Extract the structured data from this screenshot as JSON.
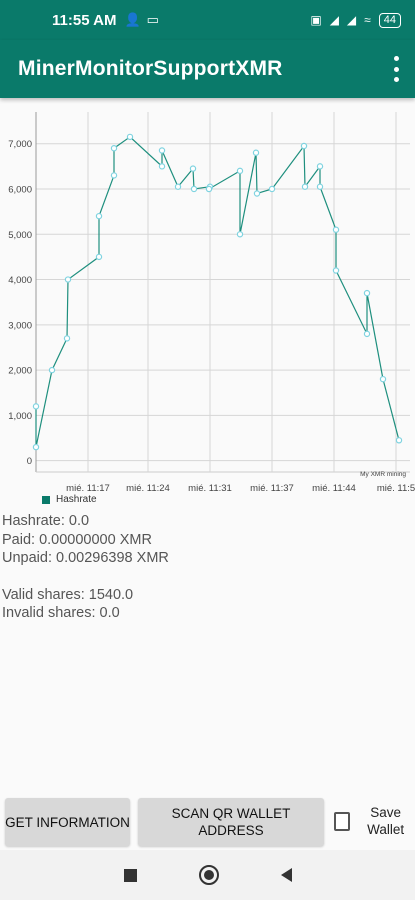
{
  "status_bar": {
    "time": "11:55 AM",
    "left_icons": [
      "person-add-icon",
      "laptop-icon"
    ],
    "right_icons": [
      "screenshot-icon",
      "signal-icon",
      "signal-icon-2",
      "wifi-icon"
    ],
    "battery": "44"
  },
  "app_bar": {
    "title": "MinerMonitorSupportXMR",
    "overflow_icon": "more-vert-icon"
  },
  "chart_data": {
    "type": "line",
    "series": [
      {
        "name": "Hashrate",
        "color": "#1e8f7e",
        "values": [
          1200,
          300,
          2000,
          2700,
          4000,
          4500,
          5400,
          6300,
          6900,
          7150,
          6500,
          6850,
          6050,
          6450,
          6000,
          6050,
          6000,
          6000,
          6400,
          5000,
          6800,
          5900,
          6000,
          6950,
          6050,
          6500,
          6050,
          5100,
          4200,
          2800,
          3700,
          1800,
          450
        ]
      }
    ],
    "x_labels": [
      "mié. 11:17",
      "mié. 11:24",
      "mié. 11:31",
      "mié. 11:37",
      "mié. 11:44",
      "mié. 11:5"
    ],
    "y_ticks": [
      "7,000",
      "6,000",
      "5,000",
      "4,000",
      "3,000",
      "2,000",
      "1,000",
      "0"
    ],
    "ylim": [
      -250,
      7700
    ],
    "description_label": "My XMR mining",
    "legend": [
      "Hashrate"
    ],
    "grid": true
  },
  "stats": {
    "hashrate": "Hashrate: 0.0",
    "paid": "Paid: 0.00000000 XMR",
    "unpaid": "Unpaid: 0.00296398 XMR",
    "valid": "Valid shares: 1540.0",
    "invalid": "Invalid shares: 0.0"
  },
  "buttons": {
    "get_info": "GET INFORMATION",
    "scan_qr": "SCAN QR WALLET ADDRESS",
    "save_wallet": "Save Wallet",
    "save_wallet_checked": false
  },
  "nav_bar": {
    "recent_icon": "square-icon",
    "home_icon": "circle-icon",
    "back_icon": "triangle-back-icon"
  }
}
